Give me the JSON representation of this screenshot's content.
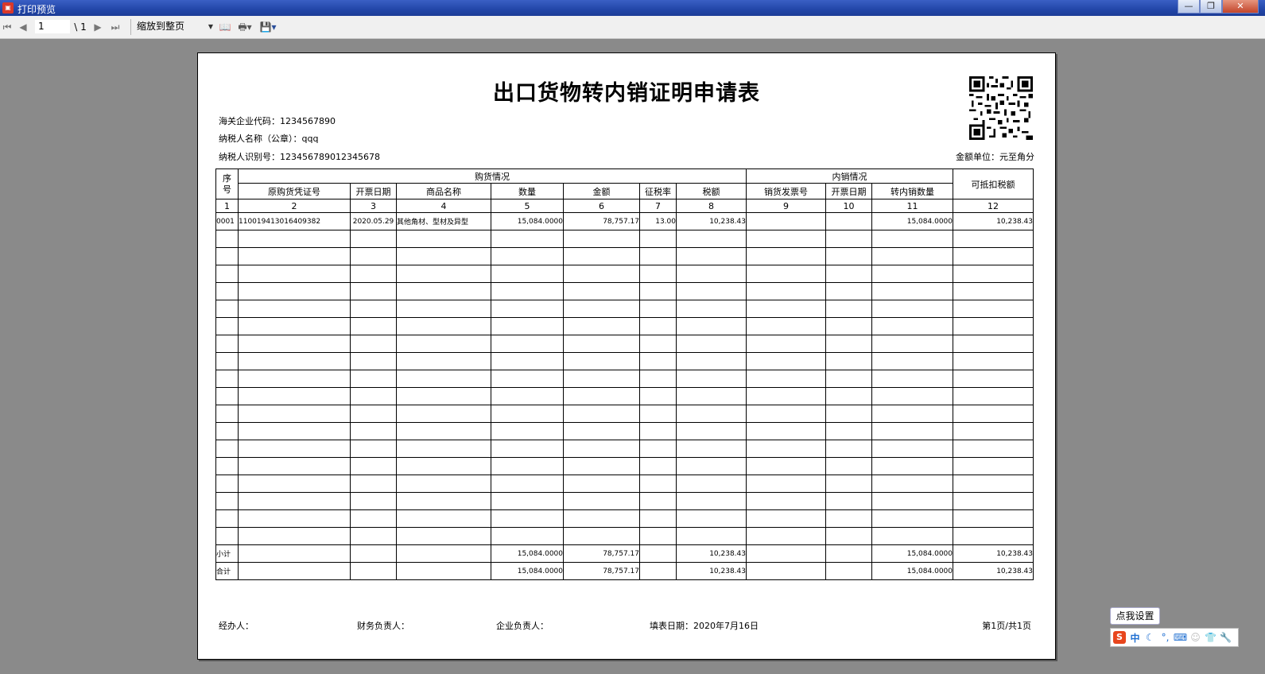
{
  "window": {
    "title": "打印预览",
    "app_icon": "app-icon",
    "minimize": "—",
    "restore": "❐",
    "close": "✕"
  },
  "toolbar": {
    "current_page": "1",
    "page_separator": "\\ 1",
    "zoom": "缩放到整页",
    "icons": [
      "first-page-icon",
      "prev-page-icon",
      "next-page-icon",
      "last-page-icon",
      "book-icon",
      "printer-icon",
      "save-icon"
    ]
  },
  "doc": {
    "title": "出口货物转内销证明申请表",
    "customs_code": "海关企业代码：1234567890",
    "taxpayer_name": "纳税人名称（公章）：qqq",
    "taxpayer_id": "纳税人识别号：123456789012345678",
    "unit": "金额单位：元至角分"
  },
  "table": {
    "seq_header": "序\n号",
    "purchase_group": "购货情况",
    "sales_group": "内销情况",
    "deductible_header": "可抵扣税额",
    "columns": [
      "原购货凭证号",
      "开票日期",
      "商品名称",
      "数量",
      "金额",
      "征税率",
      "税额",
      "销货发票号",
      "开票日期",
      "转内销数量"
    ],
    "index_row": [
      "1",
      "2",
      "3",
      "4",
      "5",
      "6",
      "7",
      "8",
      "9",
      "10",
      "11",
      "12"
    ],
    "rows": [
      [
        "0001",
        "110019413016409382",
        "2020.05.29",
        "其他角材、型材及异型",
        "15,084.0000",
        "78,757.17",
        "13.00",
        "10,238.43",
        "",
        "",
        "15,084.0000",
        "10,238.43"
      ]
    ],
    "subtotal": [
      "小计",
      "",
      "",
      "",
      "15,084.0000",
      "78,757.17",
      "",
      "10,238.43",
      "",
      "",
      "15,084.0000",
      "10,238.43"
    ],
    "total": [
      "合计",
      "",
      "",
      "",
      "15,084.0000",
      "78,757.17",
      "",
      "10,238.43",
      "",
      "",
      "15,084.0000",
      "10,238.43"
    ]
  },
  "footer": {
    "handler": "经办人：",
    "finance": "财务负责人：",
    "manager": "企业负责人：",
    "fill_date": "填表日期：2020年7月16日",
    "page_info": "第1页/共1页"
  },
  "ime": {
    "tooltip": "点我设置",
    "logo": "S",
    "mode": "中",
    "icons": [
      "moon-icon",
      "punctuation-icon",
      "keyboard-icon",
      "user-icon",
      "shirt-icon",
      "wrench-icon"
    ]
  }
}
